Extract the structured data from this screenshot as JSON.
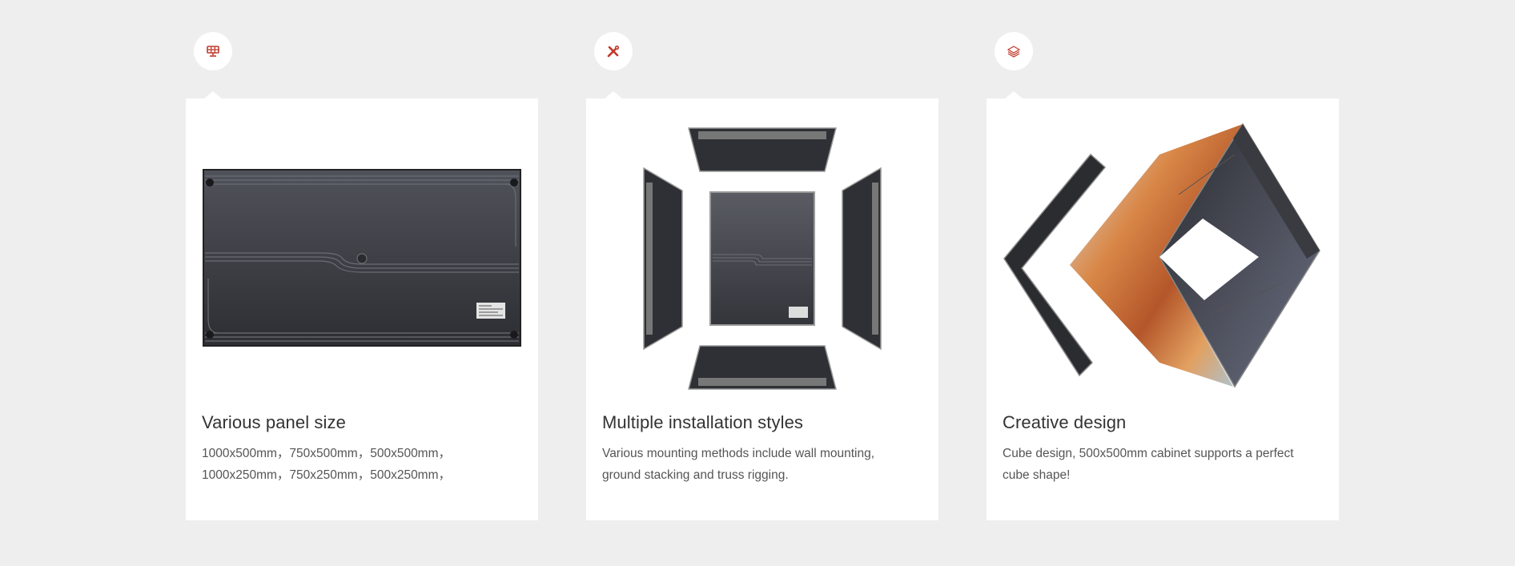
{
  "accent_color": "#c0392b",
  "features": [
    {
      "icon": "solar-panel-icon",
      "title": "Various panel size",
      "desc_line1": "1000x500mm，750x500mm，500x500mm，",
      "desc_line2": "1000x250mm，750x250mm，500x250mm，"
    },
    {
      "icon": "tools-icon",
      "title": "Multiple installation styles",
      "desc_line1": "Various mounting methods include wall mounting,",
      "desc_line2": "ground stacking and truss rigging."
    },
    {
      "icon": "layers-icon",
      "title": "Creative design",
      "desc_line1": "Cube design, 500x500mm cabinet supports a perfect",
      "desc_line2": "cube shape!"
    }
  ]
}
